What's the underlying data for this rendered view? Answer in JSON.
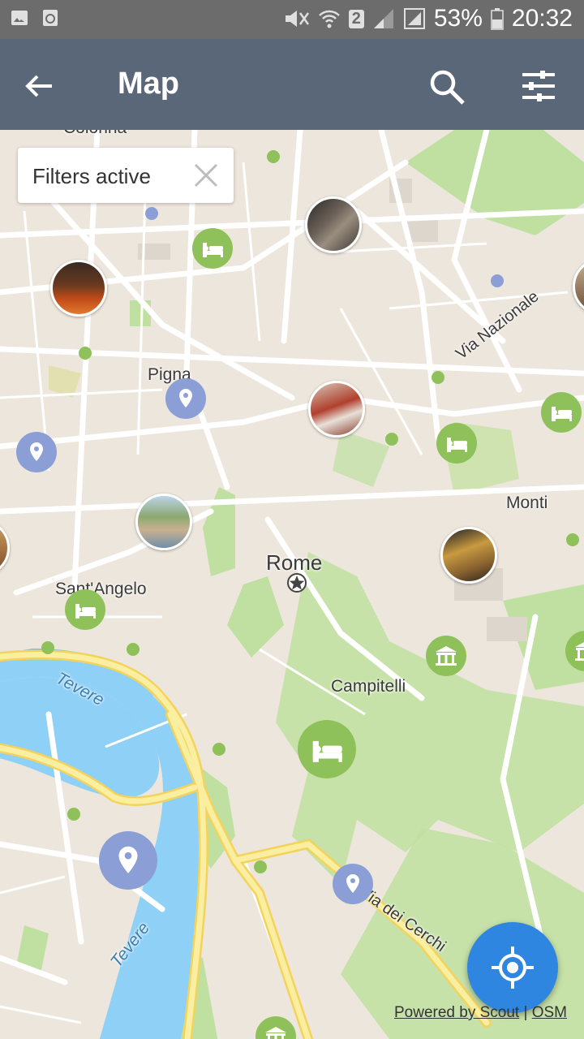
{
  "status_bar": {
    "battery": "53%",
    "time": "20:32",
    "sim_slot": "2"
  },
  "app_bar": {
    "title": "Map",
    "back_icon": "arrow-back-icon",
    "search_icon": "search-icon",
    "filter_icon": "tune-icon"
  },
  "filter_chip": {
    "label": "Filters active"
  },
  "places": {
    "colonna": "Colonna",
    "pigna": "Pigna",
    "rome": "Rome",
    "sant_angelo": "Sant'Angelo",
    "campitelli": "Campitelli",
    "monti": "Monti",
    "via_nazionale": "Via Nazionale",
    "via_dei_cerchi": "Via dei Cerchi",
    "tevere_1": "Tevere",
    "tevere_2": "Tevere"
  },
  "attribution": {
    "powered": "Powered by Scout",
    "sep": " | ",
    "osm": "OSM"
  },
  "colors": {
    "app_bar": "#5a6779",
    "status_bar": "#6c6c6c",
    "hotel_pin": "#8fc15a",
    "poi_pin": "#8b9fd6",
    "fab": "#2f86e0",
    "river": "#8fd0f6",
    "major_road": "#f7e27a",
    "park": "#bfe0a0"
  }
}
